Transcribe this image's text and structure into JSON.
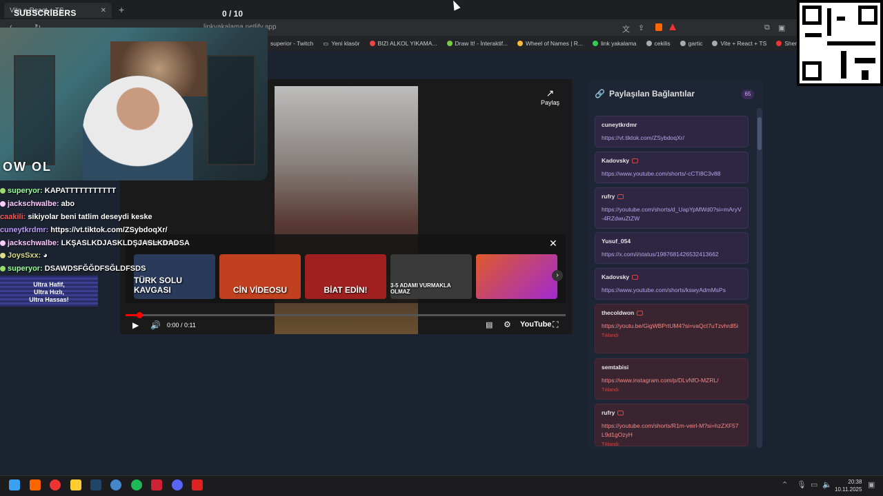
{
  "browser": {
    "tab_title": "Vite + React + TS",
    "new_tab": "+",
    "url": "linkyakalama.netlify.app",
    "bookmarks": [
      "superior - Twitch",
      "Yeni klasör",
      "BIZI ALKOL YIKAMA...",
      "Draw It! - İnteraktif...",
      "Wheel of Names | R...",
      "link yakalama",
      "cekilis",
      "gartic",
      "Vite + React + TS",
      "Sheng - BENZ"
    ]
  },
  "overlay": {
    "subscribers_label": "SUBSCRIBERS",
    "counter": "0  / 10",
    "owl_text": "OW OL"
  },
  "player": {
    "share_label": "Paylaş",
    "time": "0:00 / 0:11",
    "progress": 0.02,
    "end_title": "Gelecek video",
    "thumbnails": [
      {
        "text": "TÜRK SOLU KAVGASI",
        "color": "#2a3a5a"
      },
      {
        "text": "CİN VİDEOSU",
        "color": "#c04020"
      },
      {
        "text": "BİAT EDİN!",
        "color": "#a02020"
      },
      {
        "text": "3-5 ADAMI VURMAKLA OLMAZ",
        "color": "#3a3a3a"
      },
      {
        "text": "",
        "color": "#e05a2a"
      }
    ],
    "youtube_label": "YouTube"
  },
  "chat": [
    {
      "user": "superyor:",
      "text": "KAPATTTTTTTTTTT",
      "color": "#9f9"
    },
    {
      "user": "jackschwalbe:",
      "text": "abo",
      "color": "#fcf"
    },
    {
      "user": "caakili:",
      "text": "sikiyolar beni tatlim deseydi keske",
      "color": "#f55"
    },
    {
      "user": "cuneytkrdmr:",
      "text": "https://vt.tiktok.com/ZSybdoqXr/",
      "color": "#b9f"
    },
    {
      "user": "jackschwalbe:",
      "text": "LKŞASLKDJASKLDŞJASLKDADSA",
      "color": "#fcf"
    },
    {
      "user": "JoysSxx:",
      "text": "",
      "color": "#dd8"
    },
    {
      "user": "superyor:",
      "text": "DSAWDSFĞĞDFSĞLDFSDS",
      "color": "#9f9"
    }
  ],
  "promo": {
    "line1": "Ultra Hafif,",
    "line2": "Ultra Hızlı,",
    "line3": "Ultra Hassas!"
  },
  "links": {
    "title": "Paylaşılan Bağlantılar",
    "count": "65",
    "items": [
      {
        "user": "cuneytkrdmr",
        "url": "https://vt.tiktok.com/ZSybdoqXr/",
        "yt": false,
        "clicked": false
      },
      {
        "user": "Kadovsky",
        "url": "https://www.youtube.com/shorts/-cCTI8C3v88",
        "yt": true,
        "clicked": false
      },
      {
        "user": "rufry",
        "url": "https://youtube.com/shorts/d_UapYpMWd0?si=mAryV-4RZdwuZtZW",
        "yt": true,
        "clicked": false
      },
      {
        "user": "Yusuf_054",
        "url": "https://x.com/i/status/1987681426532413662",
        "yt": false,
        "clicked": false
      },
      {
        "user": "Kadovsky",
        "url": "https://www.youtube.com/shorts/kswyAdmMsPs",
        "yt": true,
        "clicked": false
      },
      {
        "user": "thecoldwon",
        "url": "https://youtu.be/GigWBPrtUM4?si=vaQct7uTzvhrdl5i",
        "yt": true,
        "clicked": true
      },
      {
        "user": "semtabisi",
        "url": "https://www.instagram.com/p/DLvNfO-MZRL/",
        "yt": false,
        "clicked": true
      },
      {
        "user": "rufry",
        "url": "https://youtube.com/shorts/R1m-veirl-M?si=hzZXF57L9d1gOzyH",
        "yt": true,
        "clicked": true
      }
    ],
    "clicked_label": "Tıklandı"
  },
  "taskbar": {
    "time": "20:38",
    "date": "10.11.2025"
  }
}
